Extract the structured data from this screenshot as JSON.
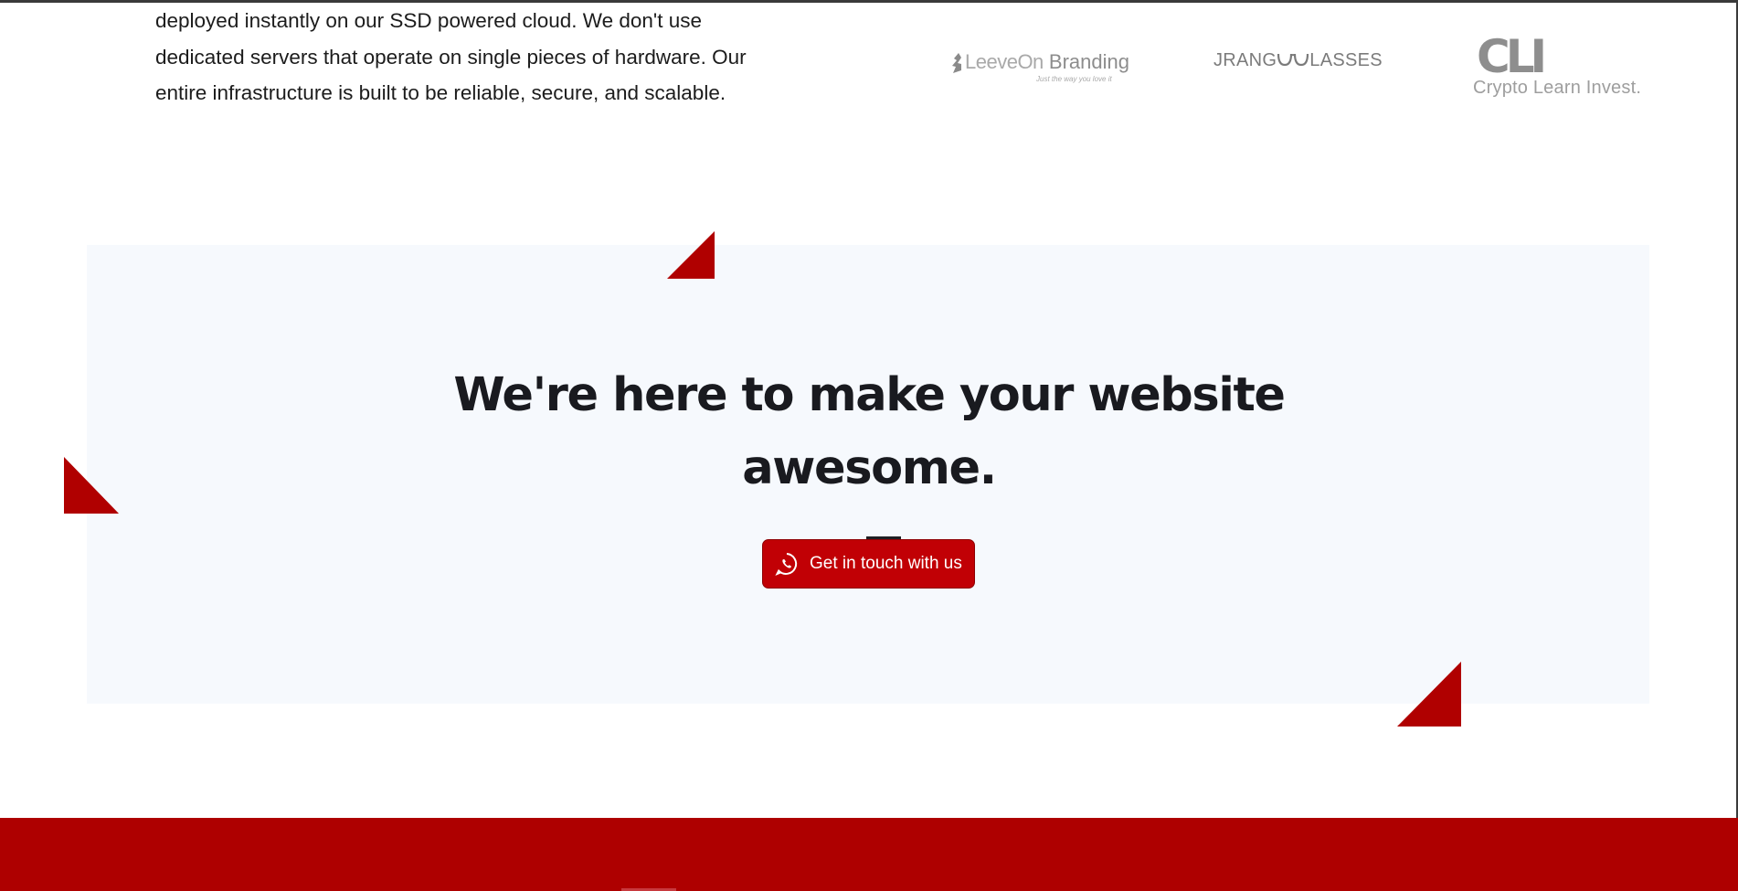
{
  "intro": {
    "lines": [
      "deployed instantly on our SSD powered cloud. We don't use",
      "dedicated servers that operate on single pieces of hardware. Our",
      "entire infrastructure is built to be reliable, secure, and scalable."
    ]
  },
  "logos": {
    "leeveon": {
      "name_light": "LeeveOn",
      "name_bold": "Branding",
      "tagline": "Just the way you love it"
    },
    "jrang": {
      "left": "JRANG",
      "right": "LASSES"
    },
    "cli": {
      "mark": "CLI",
      "name": "Crypto Learn Invest."
    }
  },
  "cta": {
    "title_line1": "We're here to make your website",
    "title_line2": "awesome.",
    "button_label": "Get in touch with us",
    "button_icon": "whatsapp-icon"
  },
  "colors": {
    "accent": "#b00000",
    "button": "#c10005",
    "panel": "#f6f9fd",
    "heading": "#191a1f"
  }
}
